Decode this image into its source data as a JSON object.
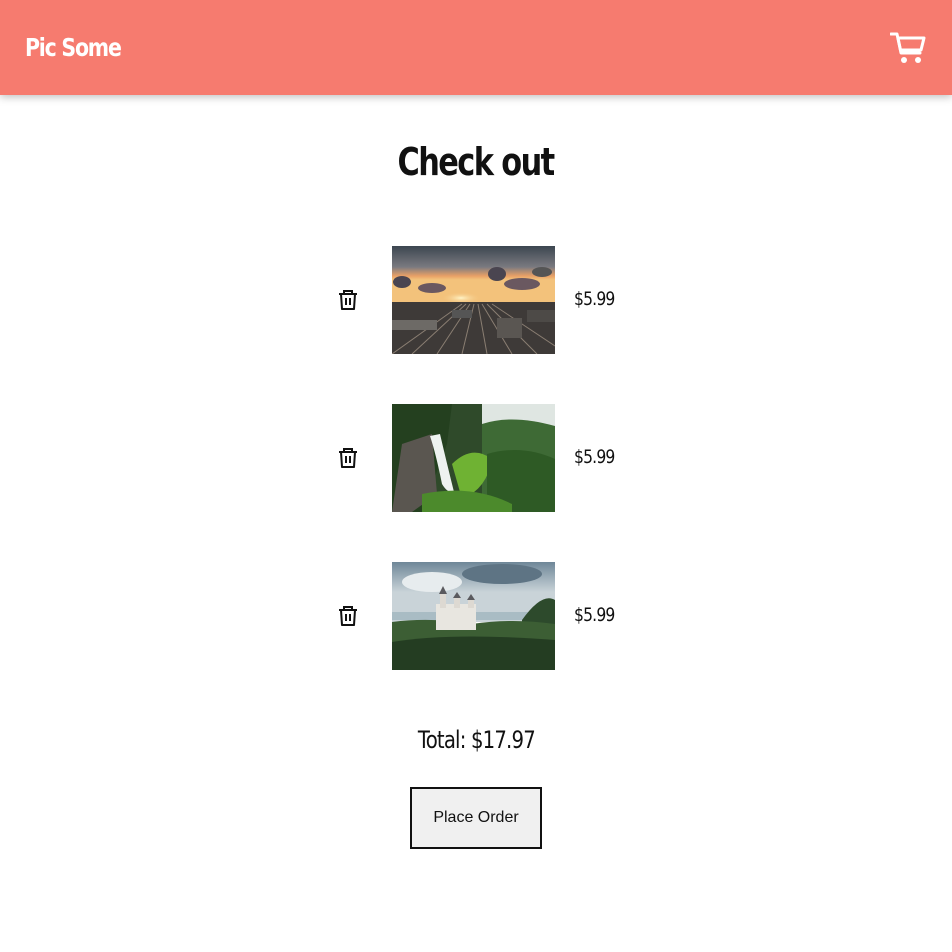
{
  "header": {
    "brand": "Pic Some",
    "cart_icon": "cart-icon",
    "background_color": "#f67b6f"
  },
  "page": {
    "title": "Check out"
  },
  "cart": {
    "items": [
      {
        "image": "railway-sunset-photo",
        "price": "$5.99",
        "remove_icon": "trash-icon"
      },
      {
        "image": "waterfall-forest-photo",
        "price": "$5.99",
        "remove_icon": "trash-icon"
      },
      {
        "image": "castle-forest-photo",
        "price": "$5.99",
        "remove_icon": "trash-icon"
      }
    ],
    "total": "Total: $17.97",
    "place_order_label": "Place Order"
  }
}
